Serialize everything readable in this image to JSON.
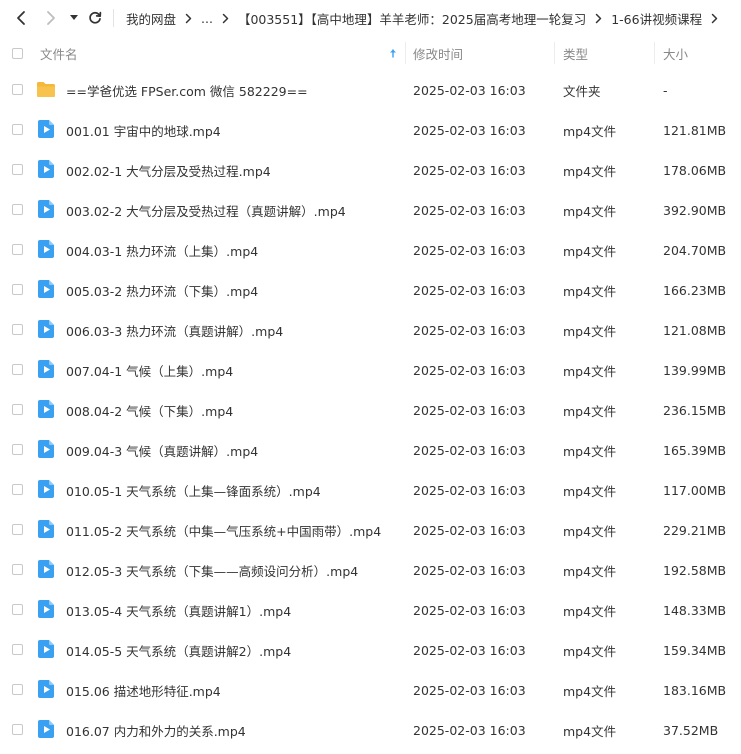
{
  "toolbar": {
    "breadcrumb": [
      {
        "label": "我的网盘",
        "name": "crumb-my-drive"
      },
      {
        "label": "...",
        "name": "crumb-ellipsis"
      },
      {
        "label": "【003551】【高中地理】羊羊老师：2025届高考地理一轮复习",
        "name": "crumb-course-folder"
      },
      {
        "label": "1-66讲视频课程",
        "name": "crumb-video-folder"
      }
    ]
  },
  "header": {
    "name": "文件名",
    "time": "修改时间",
    "type": "类型",
    "size": "大小"
  },
  "files": [
    {
      "icon": "folder",
      "name": "==学爸优选 FPSer.com 微信 582229==",
      "time": "2025-02-03 16:03",
      "type": "文件夹",
      "size": "-"
    },
    {
      "icon": "video",
      "name": "001.01 宇宙中的地球.mp4",
      "time": "2025-02-03 16:03",
      "type": "mp4文件",
      "size": "121.81MB"
    },
    {
      "icon": "video",
      "name": "002.02-1 大气分层及受热过程.mp4",
      "time": "2025-02-03 16:03",
      "type": "mp4文件",
      "size": "178.06MB"
    },
    {
      "icon": "video",
      "name": "003.02-2 大气分层及受热过程（真题讲解）.mp4",
      "time": "2025-02-03 16:03",
      "type": "mp4文件",
      "size": "392.90MB"
    },
    {
      "icon": "video",
      "name": "004.03-1 热力环流（上集）.mp4",
      "time": "2025-02-03 16:03",
      "type": "mp4文件",
      "size": "204.70MB"
    },
    {
      "icon": "video",
      "name": "005.03-2 热力环流（下集）.mp4",
      "time": "2025-02-03 16:03",
      "type": "mp4文件",
      "size": "166.23MB"
    },
    {
      "icon": "video",
      "name": "006.03-3 热力环流（真题讲解）.mp4",
      "time": "2025-02-03 16:03",
      "type": "mp4文件",
      "size": "121.08MB"
    },
    {
      "icon": "video",
      "name": "007.04-1 气候（上集）.mp4",
      "time": "2025-02-03 16:03",
      "type": "mp4文件",
      "size": "139.99MB"
    },
    {
      "icon": "video",
      "name": "008.04-2 气候（下集）.mp4",
      "time": "2025-02-03 16:03",
      "type": "mp4文件",
      "size": "236.15MB"
    },
    {
      "icon": "video",
      "name": "009.04-3 气候（真题讲解）.mp4",
      "time": "2025-02-03 16:03",
      "type": "mp4文件",
      "size": "165.39MB"
    },
    {
      "icon": "video",
      "name": "010.05-1 天气系统（上集—锋面系统）.mp4",
      "time": "2025-02-03 16:03",
      "type": "mp4文件",
      "size": "117.00MB"
    },
    {
      "icon": "video",
      "name": "011.05-2 天气系统（中集—气压系统+中国雨带）.mp4",
      "time": "2025-02-03 16:03",
      "type": "mp4文件",
      "size": "229.21MB"
    },
    {
      "icon": "video",
      "name": "012.05-3 天气系统（下集——高频设问分析）.mp4",
      "time": "2025-02-03 16:03",
      "type": "mp4文件",
      "size": "192.58MB"
    },
    {
      "icon": "video",
      "name": "013.05-4 天气系统（真题讲解1）.mp4",
      "time": "2025-02-03 16:03",
      "type": "mp4文件",
      "size": "148.33MB"
    },
    {
      "icon": "video",
      "name": "014.05-5 天气系统（真题讲解2）.mp4",
      "time": "2025-02-03 16:03",
      "type": "mp4文件",
      "size": "159.34MB"
    },
    {
      "icon": "video",
      "name": "015.06 描述地形特征.mp4",
      "time": "2025-02-03 16:03",
      "type": "mp4文件",
      "size": "183.16MB"
    },
    {
      "icon": "video",
      "name": "016.07 内力和外力的关系.mp4",
      "time": "2025-02-03 16:03",
      "type": "mp4文件",
      "size": "37.52MB"
    }
  ],
  "colors": {
    "folder": "#F5B83A",
    "video": "#3AA1F2",
    "sortArrow": "#3AA1F2"
  }
}
